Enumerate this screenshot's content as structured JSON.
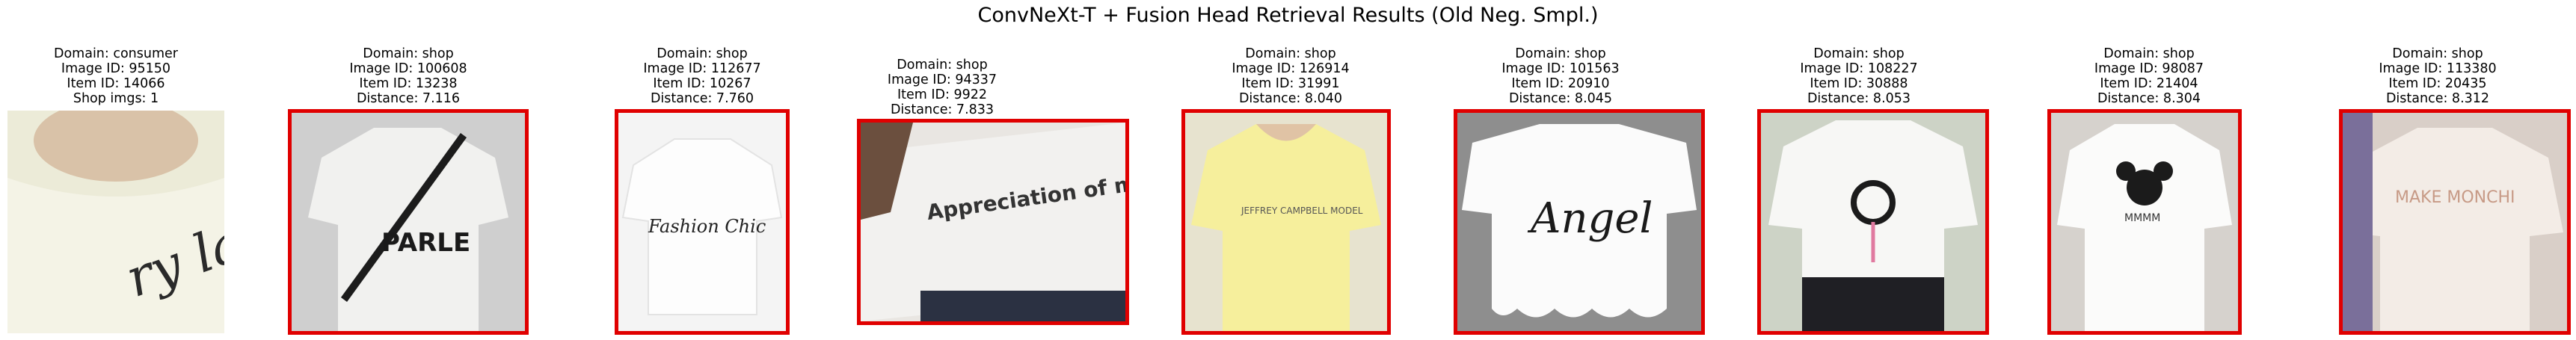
{
  "figure": {
    "title": "ConvNeXt-T + Fusion Head Retrieval Results (Old Neg. Smpl.)"
  },
  "query": {
    "domain": "Domain: consumer",
    "image_id": "Image ID: 95150",
    "item_id": "Item ID: 14066",
    "shop_imgs": "Shop imgs: 1",
    "thumb_text": "ry lady"
  },
  "results": [
    {
      "domain": "Domain: shop",
      "image_id": "Image ID: 100608",
      "item_id": "Item ID: 13238",
      "distance": "Distance: 7.116",
      "thumb_text": "PARLE",
      "match": false
    },
    {
      "domain": "Domain: shop",
      "image_id": "Image ID: 112677",
      "item_id": "Item ID: 10267",
      "distance": "Distance: 7.760",
      "thumb_text": "Fashion Chic",
      "match": false
    },
    {
      "domain": "Domain: shop",
      "image_id": "Image ID: 94337",
      "item_id": "Item ID: 9922",
      "distance": "Distance: 7.833",
      "thumb_text": "Appreciation of music",
      "match": false
    },
    {
      "domain": "Domain: shop",
      "image_id": "Image ID: 126914",
      "item_id": "Item ID: 31991",
      "distance": "Distance: 8.040",
      "thumb_text": "JEFFREY CAMPBELL MODEL",
      "match": false
    },
    {
      "domain": "Domain: shop",
      "image_id": "Image ID: 101563",
      "item_id": "Item ID: 20910",
      "distance": "Distance: 8.045",
      "thumb_text": "Angel",
      "match": false
    },
    {
      "domain": "Domain: shop",
      "image_id": "Image ID: 108227",
      "item_id": "Item ID: 30888",
      "distance": "Distance: 8.053",
      "thumb_text": "",
      "match": false
    },
    {
      "domain": "Domain: shop",
      "image_id": "Image ID: 98087",
      "item_id": "Item ID: 21404",
      "distance": "Distance: 8.304",
      "thumb_text": "MMMM",
      "match": false
    },
    {
      "domain": "Domain: shop",
      "image_id": "Image ID: 113380",
      "item_id": "Item ID: 20435",
      "distance": "Distance: 8.312",
      "thumb_text": "MAKE MONCHI",
      "match": false
    }
  ],
  "colors": {
    "mismatch_border": "#e00000",
    "background": "#ffffff"
  }
}
